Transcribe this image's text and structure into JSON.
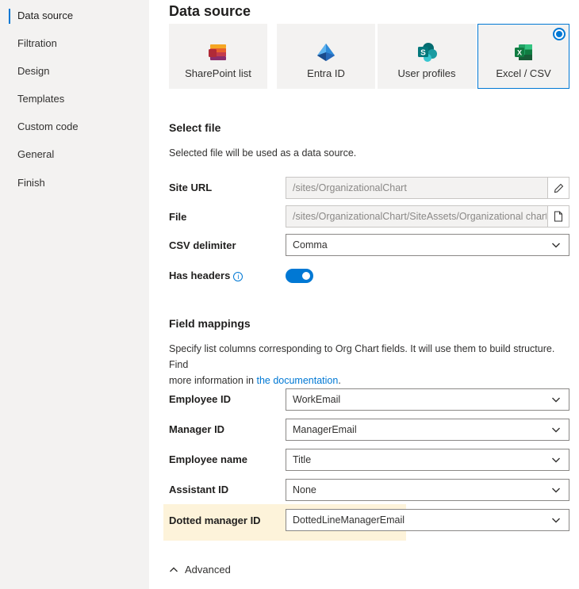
{
  "sidebar": {
    "items": [
      {
        "label": "Data source"
      },
      {
        "label": "Filtration"
      },
      {
        "label": "Design"
      },
      {
        "label": "Templates"
      },
      {
        "label": "Custom code"
      },
      {
        "label": "General"
      },
      {
        "label": "Finish"
      }
    ]
  },
  "main": {
    "title": "Data source",
    "sources": [
      {
        "label": "SharePoint list",
        "icon": "sharepoint-list-icon"
      },
      {
        "label": "Entra ID",
        "icon": "entra-id-icon"
      },
      {
        "label": "User profiles",
        "icon": "sharepoint-icon"
      },
      {
        "label": "Excel / CSV",
        "icon": "excel-icon",
        "selected": true
      }
    ],
    "select_file": {
      "title": "Select file",
      "description": "Selected file will be used as a data source.",
      "site_url_label": "Site URL",
      "site_url_value": "/sites/OrganizationalChart",
      "file_label": "File",
      "file_value": "/sites/OrganizationalChart/SiteAssets/Organizational chart.csv",
      "csv_delimiter_label": "CSV delimiter",
      "csv_delimiter_value": "Comma",
      "has_headers_label": "Has headers",
      "has_headers_on": true
    },
    "field_mappings": {
      "title": "Field mappings",
      "description_line1": "Specify list columns corresponding to Org Chart fields. It will use them to build structure. Find",
      "description_line2_prefix": "more information in ",
      "description_link": "the documentation",
      "description_line2_suffix": ".",
      "rows": [
        {
          "label": "Employee ID",
          "value": "WorkEmail"
        },
        {
          "label": "Manager ID",
          "value": "ManagerEmail"
        },
        {
          "label": "Employee name",
          "value": "Title"
        },
        {
          "label": "Assistant ID",
          "value": "None"
        },
        {
          "label": "Dotted manager ID",
          "value": "DottedLineManagerEmail"
        }
      ]
    },
    "advanced_label": "Advanced"
  },
  "colors": {
    "accent": "#0078d4",
    "sidebar_bg": "#f3f2f1",
    "highlight": "#fdf3da"
  }
}
